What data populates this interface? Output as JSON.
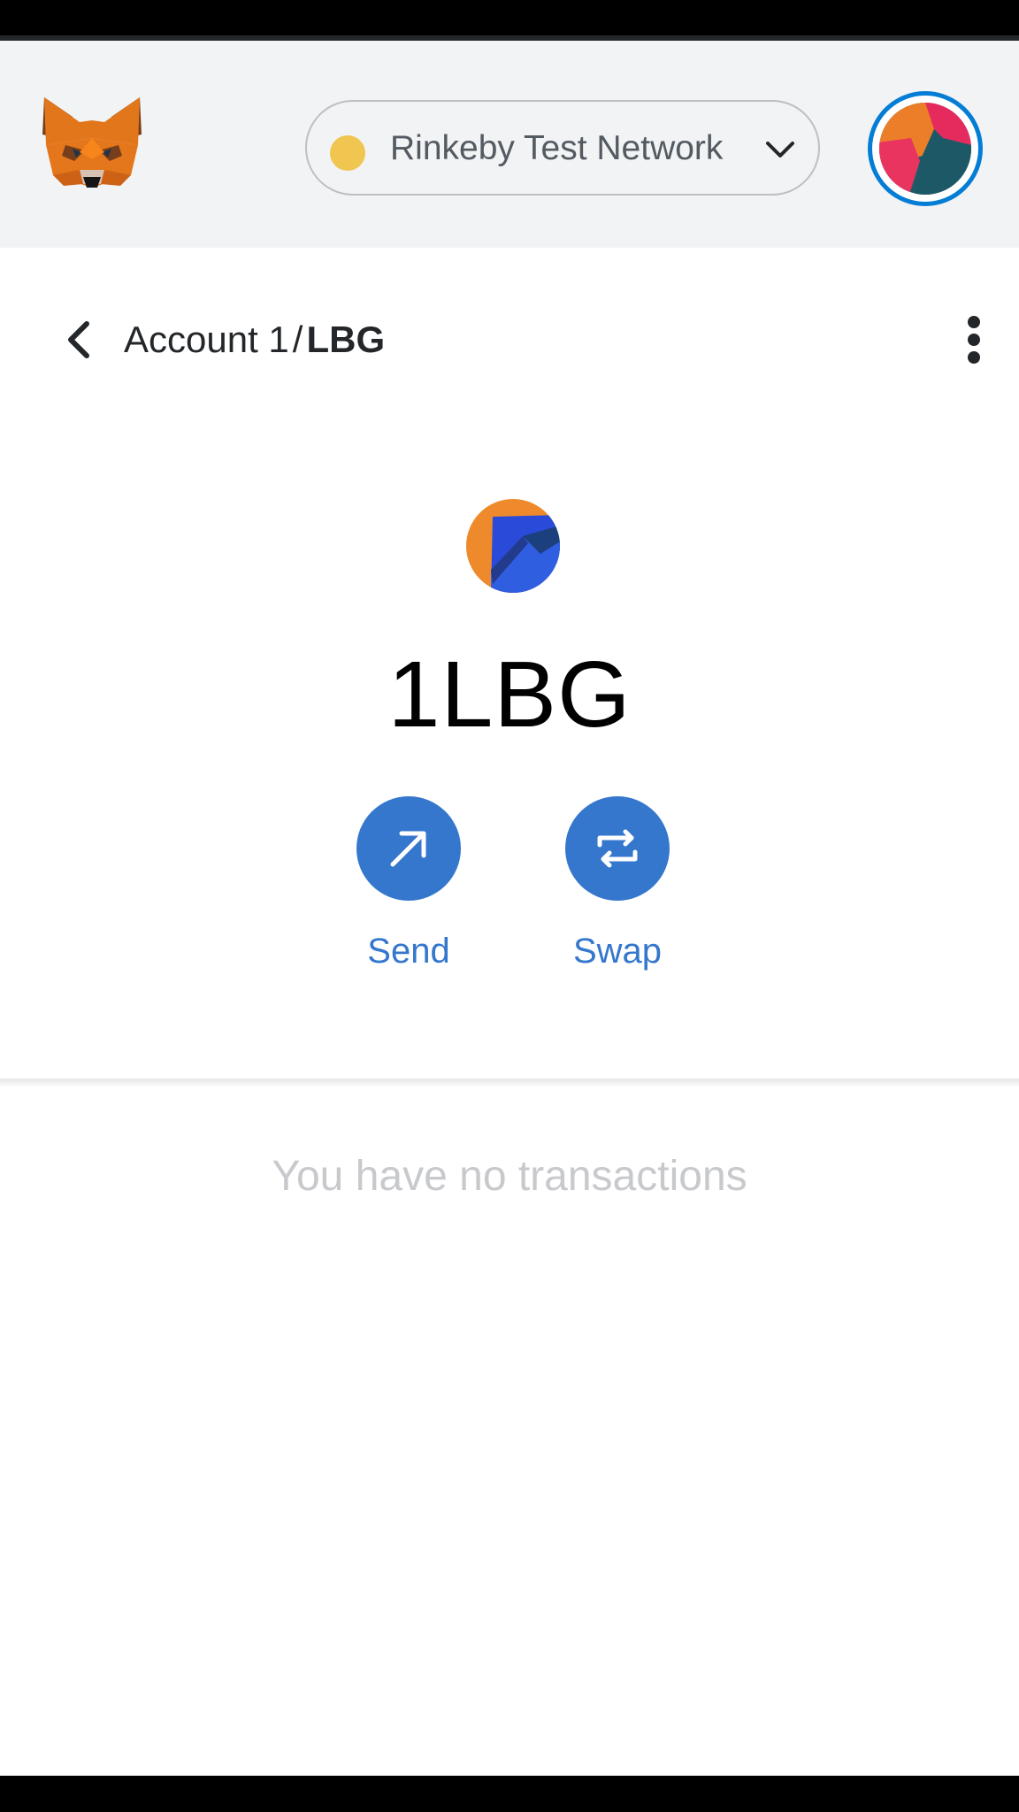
{
  "network": {
    "label": "Rinkeby Test Network",
    "status_color": "#f0c550"
  },
  "breadcrumb": {
    "account": "Account 1",
    "separator": "/",
    "token": "LBG"
  },
  "token": {
    "balance": "1LBG",
    "icon": "token-mountain-icon"
  },
  "actions": {
    "send_label": "Send",
    "swap_label": "Swap"
  },
  "transactions": {
    "empty_message": "You have no transactions"
  },
  "colors": {
    "accent": "#3477cc",
    "avatar_ring": "#037dd6",
    "header_bg": "#f2f3f4",
    "muted_text": "#c7c9cc"
  },
  "icons": {
    "logo": "metamask-fox-icon",
    "dropdown": "chevron-down-icon",
    "back": "chevron-left-icon",
    "menu": "more-vertical-icon",
    "send": "arrow-up-right-icon",
    "swap": "swap-arrows-icon"
  }
}
